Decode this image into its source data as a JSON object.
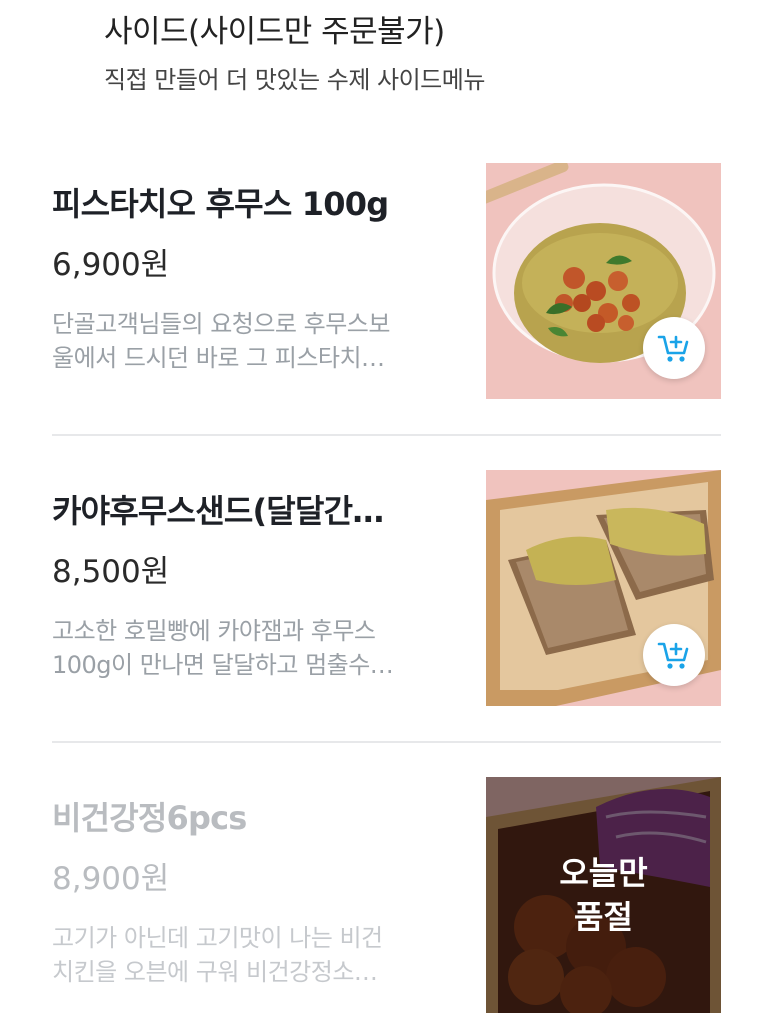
{
  "section": {
    "title": "사이드(사이드만 주문불가)",
    "subtitle": "직접 만들어 더 맛있는 수제 사이드메뉴"
  },
  "items": [
    {
      "name": "피스타치오 후무스 100g",
      "price": "6,900원",
      "desc_line1": "단골고객님들의 요청으로 후무스보",
      "desc_line2": "울에서 드시던 바로 그 피스타치…",
      "image": "hummus-bowl-photo",
      "cart_icon": "add-to-cart-icon",
      "sold_out": false
    },
    {
      "name": "카야후무스샌드(달달간…",
      "price": "8,500원",
      "desc_line1": "고소한 호밀빵에 카야잼과 후무스",
      "desc_line2": "100g이 만나면 달달하고 멈출수…",
      "image": "kaya-hummus-sandwich-photo",
      "cart_icon": "add-to-cart-icon",
      "sold_out": false
    },
    {
      "name": "비건강정6pcs",
      "price": "8,900원",
      "desc_line1": "고기가 아닌데 고기맛이 나는 비건",
      "desc_line2": "치킨을 오븐에 구워 비건강정소…",
      "image": "vegan-gangjeong-photo",
      "sold_out": true,
      "sold_out_label": "오늘만\n품절"
    }
  ],
  "colors": {
    "accent": "#1aa3e8",
    "muted_text": "#9aa0a6",
    "divider": "#e7e8ea",
    "photo_background": "#f0c3be"
  }
}
